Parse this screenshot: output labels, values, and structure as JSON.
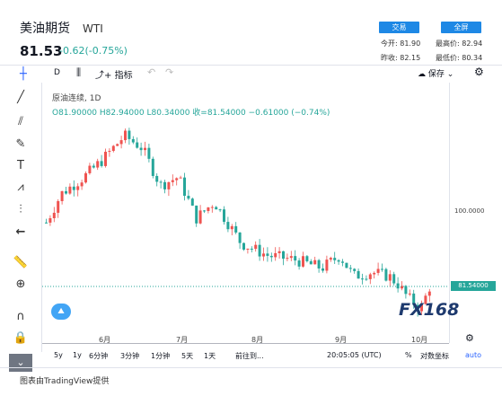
{
  "header": {
    "title": "美油期货",
    "symbol": "WTI",
    "price": "81.53",
    "change": "-0.62(-0.75%)",
    "trade_button": "交易",
    "fullscreen_button": "全屏"
  },
  "stats": {
    "open_label": "今开:",
    "open": "81.90",
    "high_label": "最高价:",
    "high": "82.94",
    "prev_label": "昨收:",
    "prev": "82.15",
    "low_label": "最低价:",
    "low": "80.34"
  },
  "toolbar": {
    "interval": "D",
    "indicators": "指标",
    "save": "保存"
  },
  "legend": {
    "title": "原油连续, 1D",
    "ohlc": "O81.90000  H82.94000  L80.34000  收=81.54000  −0.61000 (−0.74%)"
  },
  "chart_data": {
    "type": "candlestick",
    "x_ticks": [
      "6月",
      "7月",
      "8月",
      "9月",
      "10月"
    ],
    "y_ticks": [
      "100.0000"
    ],
    "last_price_label": "81.54000",
    "colors": {
      "up": "#ef5350",
      "down": "#26a69a",
      "last": "#26a69a"
    }
  },
  "watermark": "FX168",
  "bottom": {
    "ranges": [
      "5y",
      "1y",
      "6分钟",
      "3分钟",
      "1分钟",
      "5天",
      "1天"
    ],
    "goto": "前往到...",
    "time": "20:05:05 (UTC)",
    "percent": "%",
    "log": "对数坐标",
    "auto": "auto"
  },
  "footer": "图表由TradingView提供"
}
